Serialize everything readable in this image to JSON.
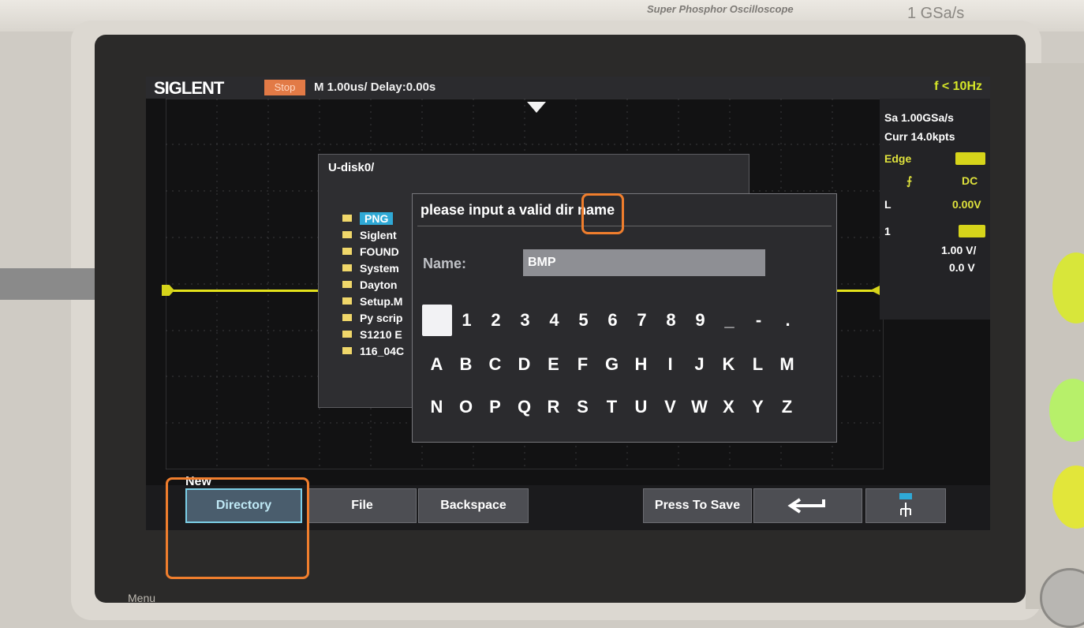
{
  "bezel": {
    "brand_line": "Super Phosphor Oscilloscope",
    "sample_rate": "1 GSa/s",
    "menu_label": "Menu"
  },
  "topbar": {
    "logo": "SIGLENT",
    "status": "Stop",
    "timebase": "M 1.00us/ Delay:0.00s",
    "freq": "f < 10Hz"
  },
  "right_panel": {
    "sample_rate": "Sa 1.00GSa/s",
    "curr": "Curr 14.0kpts",
    "trigger_type": "Edge",
    "coupling": "DC",
    "level_label": "L",
    "level_value": "0.00V",
    "channel_num": "1",
    "volts_div": "1.00 V/",
    "offset": "0.0 V"
  },
  "file_browser": {
    "path": "U-disk0/",
    "items": [
      "PNG",
      "Siglent",
      "FOUND",
      "System",
      "Dayton",
      "Setup.M",
      "Py scrip",
      "S1210 E",
      "116_04C"
    ]
  },
  "dialog": {
    "title": "please input a valid dir name",
    "name_label": "Name:",
    "name_value": "BMP",
    "keys_row1": [
      "",
      "1",
      "2",
      "3",
      "4",
      "5",
      "6",
      "7",
      "8",
      "9",
      "_",
      "-",
      "."
    ],
    "keys_row2": [
      "A",
      "B",
      "C",
      "D",
      "E",
      "F",
      "G",
      "H",
      "I",
      "J",
      "K",
      "L",
      "M"
    ],
    "keys_row3": [
      "N",
      "O",
      "P",
      "Q",
      "R",
      "S",
      "T",
      "U",
      "V",
      "W",
      "X",
      "Y",
      "Z"
    ]
  },
  "softkeys": {
    "group_label": "New",
    "directory": "Directory",
    "file": "File",
    "backspace": "Backspace",
    "press_to_save": "Press To Save",
    "back_icon": "return-arrow-icon",
    "usb_icon": "usb-network-icon"
  },
  "colors": {
    "trace": "#e4e21b",
    "highlight": "#2fa9d6",
    "annotation": "#f07e2d"
  }
}
